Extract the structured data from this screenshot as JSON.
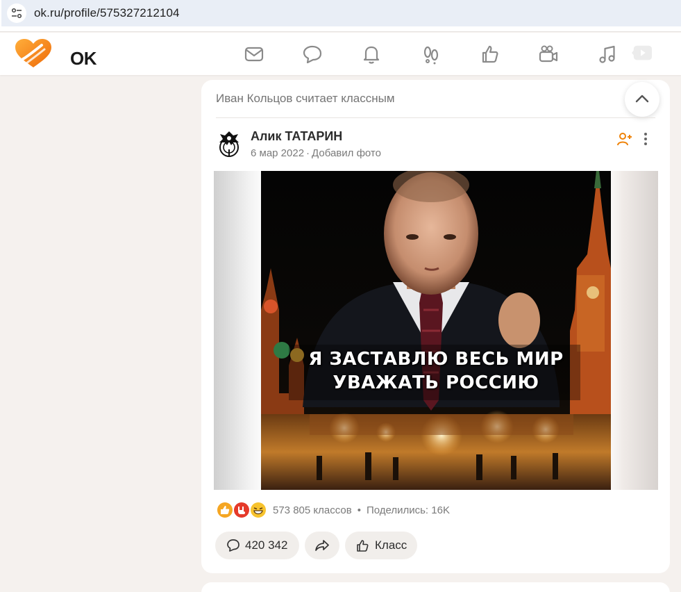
{
  "browser": {
    "url": "ok.ru/profile/575327212104"
  },
  "header": {
    "logo_text": "OK",
    "nav": [
      {
        "icon": "mail-icon"
      },
      {
        "icon": "chat-icon"
      },
      {
        "icon": "bell-icon"
      },
      {
        "icon": "footprints-icon"
      },
      {
        "icon": "thumbs-up-icon"
      },
      {
        "icon": "video-camera-icon"
      },
      {
        "icon": "music-note-icon"
      },
      {
        "icon": "video-play-icon"
      }
    ],
    "accent": "#ee8208"
  },
  "post": {
    "liked_by": "Иван Кольцов считает классным",
    "author": "Алик ТАТАРИН",
    "date": "6 мар 2022",
    "meta_separator": "·",
    "action": "Добавил фото",
    "photo_caption_line1": "Я ЗАСТАВЛЮ ВЕСЬ МИР",
    "photo_caption_line2": "УВАЖАТЬ РОССИЮ",
    "reaction_icons": [
      "like-reaction-icon",
      "rock-reaction-icon",
      "laugh-reaction-icon"
    ],
    "class_count": "573 805 классов",
    "bullet": "•",
    "shares": "Поделились: 16K",
    "comments_count": "420 342",
    "class_button_label": "Класс"
  }
}
